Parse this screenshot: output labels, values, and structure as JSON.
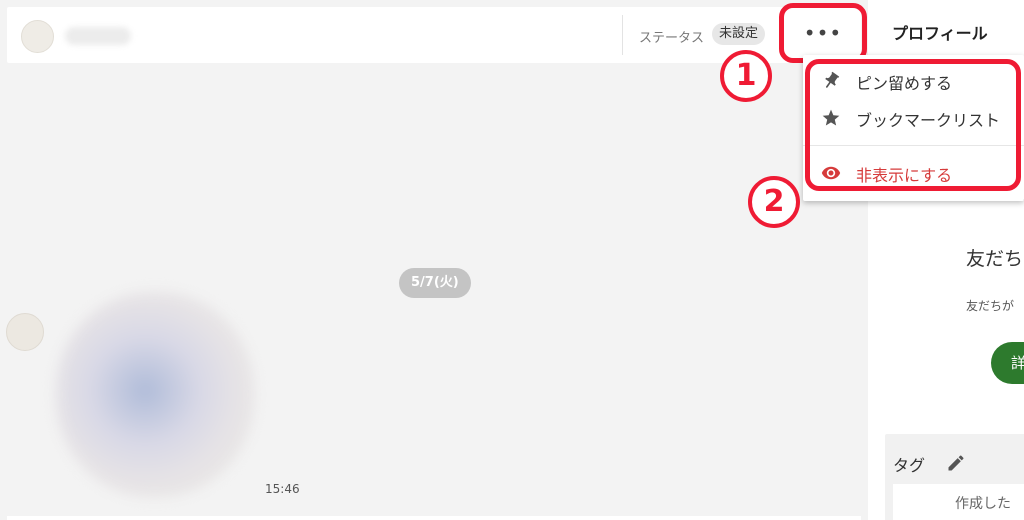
{
  "header": {
    "status_label": "ステータス",
    "status_value": "未設定",
    "more_label": "•••"
  },
  "chat": {
    "date_chip": "5/7(火)",
    "message_time": "15:46"
  },
  "menu": {
    "items": [
      {
        "label": "ピン留めする",
        "icon": "pin-icon"
      },
      {
        "label": "ブックマークリスト",
        "icon": "star-icon"
      },
      {
        "label": "非表示にする",
        "icon": "eye-icon",
        "color": "#d63b3b"
      }
    ]
  },
  "annotations": {
    "step1": "1",
    "step2": "2",
    "color": "#ef1b34"
  },
  "profile": {
    "title": "プロフィール",
    "friend_heading": "友だち",
    "friend_desc": "友だちが",
    "details_button": "詳",
    "tag_label": "タグ",
    "tag_placeholder": "作成した"
  }
}
